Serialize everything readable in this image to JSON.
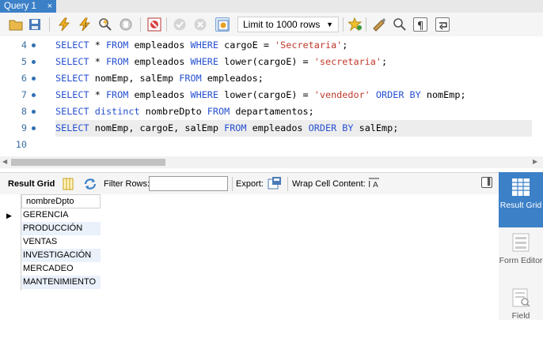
{
  "tab": {
    "title": "Query 1",
    "close": "×"
  },
  "toolbar": {
    "limit_label": "Limit to 1000 rows",
    "icons": [
      "folder-icon",
      "save-icon",
      "execute-icon",
      "execute-current-icon",
      "explain-icon",
      "stop-icon",
      "toggle-error-icon",
      "commit-icon",
      "rollback-icon",
      "autocommit-icon",
      "limit-dropdown",
      "bookmark-icon",
      "beautify-icon",
      "find-icon",
      "invisible-chars-icon",
      "wrap-icon"
    ]
  },
  "editor": {
    "lines": [
      {
        "num": "4",
        "tokens": [
          [
            "kw",
            "SELECT"
          ],
          [
            "t",
            " * "
          ],
          [
            "kw",
            "FROM"
          ],
          [
            "t",
            " empleados "
          ],
          [
            "kw",
            "WHERE"
          ],
          [
            "t",
            " cargoE = "
          ],
          [
            "str",
            "'Secretaria'"
          ],
          [
            "t",
            ";"
          ]
        ]
      },
      {
        "num": "5",
        "tokens": [
          [
            "kw",
            "SELECT"
          ],
          [
            "t",
            " * "
          ],
          [
            "kw",
            "FROM"
          ],
          [
            "t",
            " empleados "
          ],
          [
            "kw",
            "WHERE"
          ],
          [
            "t",
            " lower(cargoE) = "
          ],
          [
            "str",
            "'secretaria'"
          ],
          [
            "t",
            ";"
          ]
        ]
      },
      {
        "num": "6",
        "tokens": [
          [
            "kw",
            "SELECT"
          ],
          [
            "t",
            " nomEmp, salEmp "
          ],
          [
            "kw",
            "FROM"
          ],
          [
            "t",
            " empleados;"
          ]
        ]
      },
      {
        "num": "7",
        "tokens": [
          [
            "kw",
            "SELECT"
          ],
          [
            "t",
            " * "
          ],
          [
            "kw",
            "FROM"
          ],
          [
            "t",
            " empleados "
          ],
          [
            "kw",
            "WHERE"
          ],
          [
            "t",
            " lower(cargoE) = "
          ],
          [
            "str",
            "'vendedor'"
          ],
          [
            "t",
            " "
          ],
          [
            "kw",
            "ORDER BY"
          ],
          [
            "t",
            " nomEmp;"
          ]
        ]
      },
      {
        "num": "8",
        "tokens": [
          [
            "kw",
            "SELECT"
          ],
          [
            "t",
            " "
          ],
          [
            "kw",
            "distinct"
          ],
          [
            "t",
            " nombreDpto "
          ],
          [
            "kw",
            "FROM"
          ],
          [
            "t",
            " departamentos;"
          ]
        ]
      },
      {
        "num": "9",
        "tokens": [
          [
            "kw",
            "SELECT"
          ],
          [
            "t",
            " nomEmp, cargoE, salEmp "
          ],
          [
            "kw",
            "FROM"
          ],
          [
            "t",
            " empleados "
          ],
          [
            "kw",
            "ORDER BY"
          ],
          [
            "t",
            " salEmp;"
          ]
        ]
      },
      {
        "num": "10",
        "tokens": []
      }
    ]
  },
  "results": {
    "result_grid_label": "Result Grid",
    "filter_label": "Filter Rows:",
    "filter_value": "",
    "export_label": "Export:",
    "wrap_label": "Wrap Cell Content:",
    "column_header": "nombreDpto",
    "rows": [
      "GERENCIA",
      "PRODUCCIÓN",
      "VENTAS",
      "INVESTIGACIÓN",
      "MERCADEO",
      "MANTENIMIENTO"
    ]
  },
  "side_panel": [
    {
      "label": "Result Grid",
      "icon": "result-grid-icon",
      "active": true
    },
    {
      "label": "Form Editor",
      "icon": "form-editor-icon",
      "active": false
    },
    {
      "label": "Field",
      "icon": "field-types-icon",
      "active": false
    }
  ],
  "colors": {
    "accent": "#3c80c8",
    "keyword": "#2650d0",
    "string": "#c0392b",
    "line_number": "#3d6fa0"
  }
}
